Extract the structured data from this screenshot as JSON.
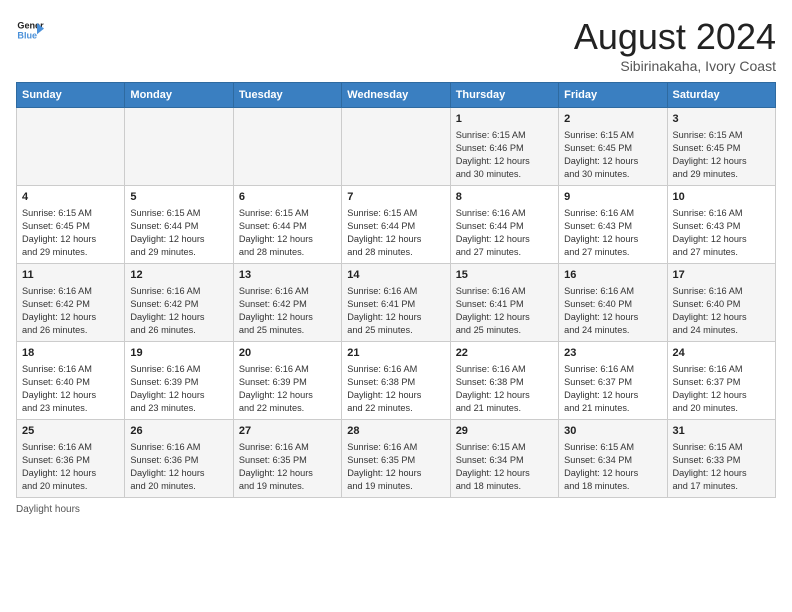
{
  "header": {
    "logo_line1": "General",
    "logo_line2": "Blue",
    "month_title": "August 2024",
    "location": "Sibirinakaha, Ivory Coast"
  },
  "days_of_week": [
    "Sunday",
    "Monday",
    "Tuesday",
    "Wednesday",
    "Thursday",
    "Friday",
    "Saturday"
  ],
  "weeks": [
    [
      {
        "day": "",
        "info": ""
      },
      {
        "day": "",
        "info": ""
      },
      {
        "day": "",
        "info": ""
      },
      {
        "day": "",
        "info": ""
      },
      {
        "day": "1",
        "info": "Sunrise: 6:15 AM\nSunset: 6:46 PM\nDaylight: 12 hours\nand 30 minutes."
      },
      {
        "day": "2",
        "info": "Sunrise: 6:15 AM\nSunset: 6:45 PM\nDaylight: 12 hours\nand 30 minutes."
      },
      {
        "day": "3",
        "info": "Sunrise: 6:15 AM\nSunset: 6:45 PM\nDaylight: 12 hours\nand 29 minutes."
      }
    ],
    [
      {
        "day": "4",
        "info": "Sunrise: 6:15 AM\nSunset: 6:45 PM\nDaylight: 12 hours\nand 29 minutes."
      },
      {
        "day": "5",
        "info": "Sunrise: 6:15 AM\nSunset: 6:44 PM\nDaylight: 12 hours\nand 29 minutes."
      },
      {
        "day": "6",
        "info": "Sunrise: 6:15 AM\nSunset: 6:44 PM\nDaylight: 12 hours\nand 28 minutes."
      },
      {
        "day": "7",
        "info": "Sunrise: 6:15 AM\nSunset: 6:44 PM\nDaylight: 12 hours\nand 28 minutes."
      },
      {
        "day": "8",
        "info": "Sunrise: 6:16 AM\nSunset: 6:44 PM\nDaylight: 12 hours\nand 27 minutes."
      },
      {
        "day": "9",
        "info": "Sunrise: 6:16 AM\nSunset: 6:43 PM\nDaylight: 12 hours\nand 27 minutes."
      },
      {
        "day": "10",
        "info": "Sunrise: 6:16 AM\nSunset: 6:43 PM\nDaylight: 12 hours\nand 27 minutes."
      }
    ],
    [
      {
        "day": "11",
        "info": "Sunrise: 6:16 AM\nSunset: 6:42 PM\nDaylight: 12 hours\nand 26 minutes."
      },
      {
        "day": "12",
        "info": "Sunrise: 6:16 AM\nSunset: 6:42 PM\nDaylight: 12 hours\nand 26 minutes."
      },
      {
        "day": "13",
        "info": "Sunrise: 6:16 AM\nSunset: 6:42 PM\nDaylight: 12 hours\nand 25 minutes."
      },
      {
        "day": "14",
        "info": "Sunrise: 6:16 AM\nSunset: 6:41 PM\nDaylight: 12 hours\nand 25 minutes."
      },
      {
        "day": "15",
        "info": "Sunrise: 6:16 AM\nSunset: 6:41 PM\nDaylight: 12 hours\nand 25 minutes."
      },
      {
        "day": "16",
        "info": "Sunrise: 6:16 AM\nSunset: 6:40 PM\nDaylight: 12 hours\nand 24 minutes."
      },
      {
        "day": "17",
        "info": "Sunrise: 6:16 AM\nSunset: 6:40 PM\nDaylight: 12 hours\nand 24 minutes."
      }
    ],
    [
      {
        "day": "18",
        "info": "Sunrise: 6:16 AM\nSunset: 6:40 PM\nDaylight: 12 hours\nand 23 minutes."
      },
      {
        "day": "19",
        "info": "Sunrise: 6:16 AM\nSunset: 6:39 PM\nDaylight: 12 hours\nand 23 minutes."
      },
      {
        "day": "20",
        "info": "Sunrise: 6:16 AM\nSunset: 6:39 PM\nDaylight: 12 hours\nand 22 minutes."
      },
      {
        "day": "21",
        "info": "Sunrise: 6:16 AM\nSunset: 6:38 PM\nDaylight: 12 hours\nand 22 minutes."
      },
      {
        "day": "22",
        "info": "Sunrise: 6:16 AM\nSunset: 6:38 PM\nDaylight: 12 hours\nand 21 minutes."
      },
      {
        "day": "23",
        "info": "Sunrise: 6:16 AM\nSunset: 6:37 PM\nDaylight: 12 hours\nand 21 minutes."
      },
      {
        "day": "24",
        "info": "Sunrise: 6:16 AM\nSunset: 6:37 PM\nDaylight: 12 hours\nand 20 minutes."
      }
    ],
    [
      {
        "day": "25",
        "info": "Sunrise: 6:16 AM\nSunset: 6:36 PM\nDaylight: 12 hours\nand 20 minutes."
      },
      {
        "day": "26",
        "info": "Sunrise: 6:16 AM\nSunset: 6:36 PM\nDaylight: 12 hours\nand 20 minutes."
      },
      {
        "day": "27",
        "info": "Sunrise: 6:16 AM\nSunset: 6:35 PM\nDaylight: 12 hours\nand 19 minutes."
      },
      {
        "day": "28",
        "info": "Sunrise: 6:16 AM\nSunset: 6:35 PM\nDaylight: 12 hours\nand 19 minutes."
      },
      {
        "day": "29",
        "info": "Sunrise: 6:15 AM\nSunset: 6:34 PM\nDaylight: 12 hours\nand 18 minutes."
      },
      {
        "day": "30",
        "info": "Sunrise: 6:15 AM\nSunset: 6:34 PM\nDaylight: 12 hours\nand 18 minutes."
      },
      {
        "day": "31",
        "info": "Sunrise: 6:15 AM\nSunset: 6:33 PM\nDaylight: 12 hours\nand 17 minutes."
      }
    ]
  ],
  "legend": "Daylight hours"
}
